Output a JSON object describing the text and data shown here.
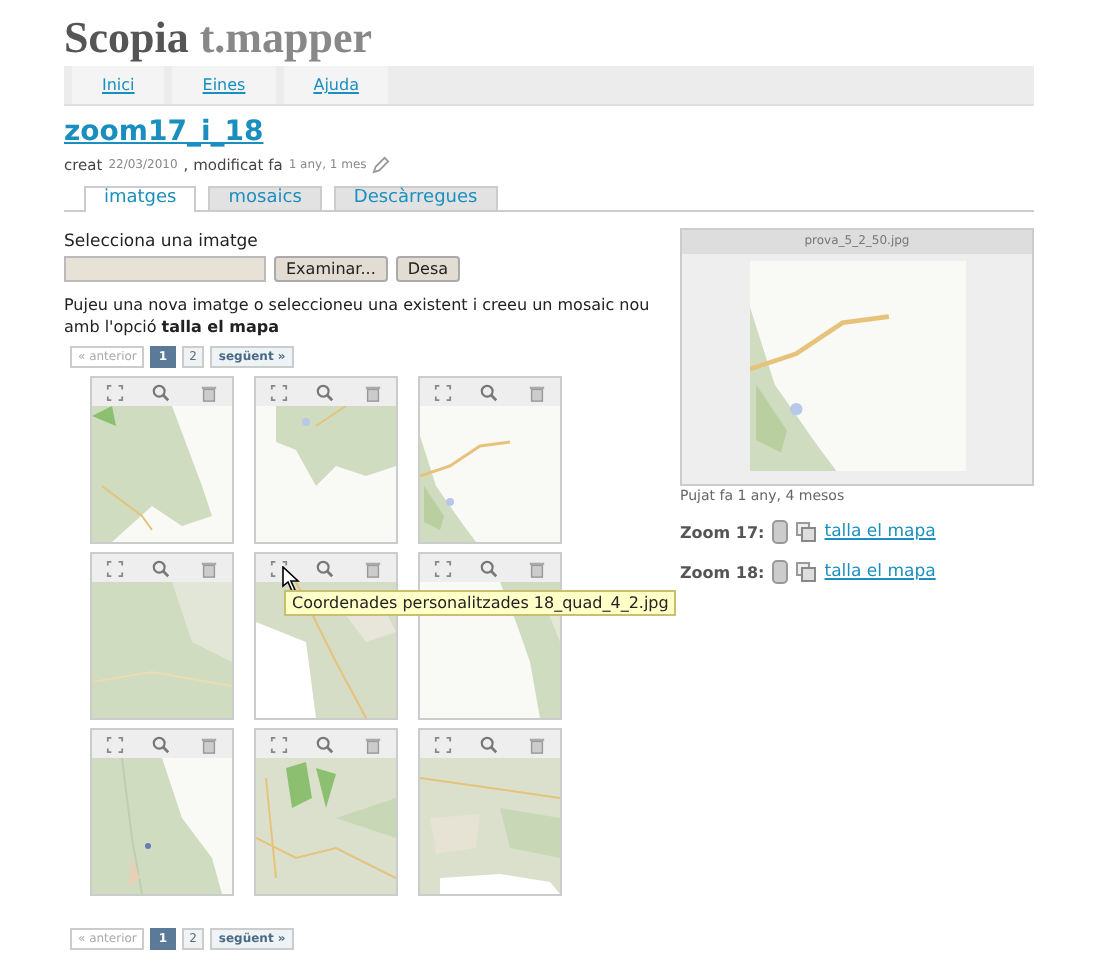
{
  "site": {
    "logo_main": "Scopia",
    "logo_sub": "t.mapper"
  },
  "nav": [
    {
      "label": "Inici"
    },
    {
      "label": "Eines"
    },
    {
      "label": "Ajuda"
    }
  ],
  "page": {
    "title": "zoom17_i_18",
    "meta": [
      {
        "kind": "label",
        "text": "creat"
      },
      {
        "kind": "value",
        "text": "22/03/2010"
      },
      {
        "kind": "label",
        "text": ", modificat fa"
      },
      {
        "kind": "value",
        "text": "1 any, 1 mes"
      }
    ]
  },
  "tabs": [
    {
      "label": "imatges",
      "selected": true
    },
    {
      "label": "mosaics",
      "selected": false
    },
    {
      "label": "Descàrregues",
      "selected": false
    }
  ],
  "upload": {
    "label": "Selecciona una imatge",
    "browse": "Examinar...",
    "save": "Desa"
  },
  "instructions": "Pujeu una nova imatge o seleccioneu una existent i creeu un mosaic nou amb l'opció **talla el mapa**",
  "pagination_top": {
    "prev": "« anterior",
    "prev_disabled": true,
    "pages": [
      {
        "label": "1",
        "selected": true
      },
      {
        "label": "2",
        "selected": false
      }
    ],
    "next": "següent »"
  },
  "tooltip": {
    "text": "Coordenades personalitzades 18_quad_4_2.jpg"
  },
  "pagination_bottom": {
    "prev": "« anterior",
    "prev_disabled": true,
    "pages": [
      {
        "label": "1",
        "selected": true
      },
      {
        "label": "2",
        "selected": false
      }
    ],
    "next": "següent »"
  },
  "preview": {
    "filename": "prova_5_2_50.jpg",
    "uploaded": "Pujat fa 1 any, 4 mesos"
  },
  "zooms": [
    {
      "label": "Zoom 17:",
      "link": "talla el mapa"
    },
    {
      "label": "Zoom 18:",
      "link": "talla el mapa"
    }
  ]
}
